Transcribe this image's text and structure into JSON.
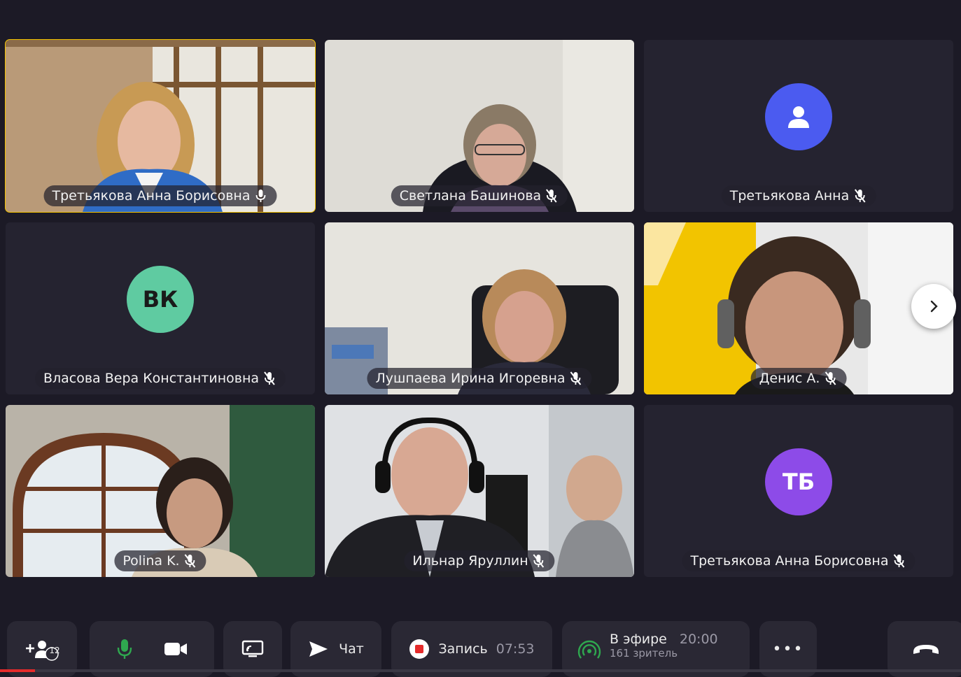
{
  "participants": [
    {
      "name": "Третьякова Анна Борисовна",
      "mic": "on",
      "video": true,
      "active": true
    },
    {
      "name": "Светлана Башинова",
      "mic": "off",
      "video": true
    },
    {
      "name": "Третьякова Анна",
      "mic": "off",
      "video": false,
      "avatar_icon": "user-icon",
      "avatar_color": "#4b5bf0"
    },
    {
      "name": "Власова Вера Константиновна",
      "mic": "off",
      "video": false,
      "initials": "ВК",
      "avatar_color": "#5fcba1"
    },
    {
      "name": "Лушпаева Ирина Игоревна",
      "mic": "off",
      "video": true
    },
    {
      "name": "Денис А.",
      "mic": "off",
      "video": true
    },
    {
      "name": "Polina K.",
      "mic": "off",
      "video": true
    },
    {
      "name": "Ильнар Яруллин",
      "mic": "off",
      "video": true
    },
    {
      "name": "Третьякова Анна Борисовна",
      "mic": "off",
      "video": false,
      "initials": "ТБ",
      "avatar_color": "#8d4be8"
    }
  ],
  "toolbar": {
    "participants_count": "12",
    "chat_label": "Чат",
    "record_label": "Запись",
    "record_time": "07:53",
    "live_label": "В эфире",
    "live_time": "20:00",
    "viewers": "161 зритель",
    "more": "•••"
  },
  "colors": {
    "active_border": "#f5c400",
    "record": "#e52b2b",
    "live": "#2fa84f",
    "mic_on": "#2fa84f"
  }
}
